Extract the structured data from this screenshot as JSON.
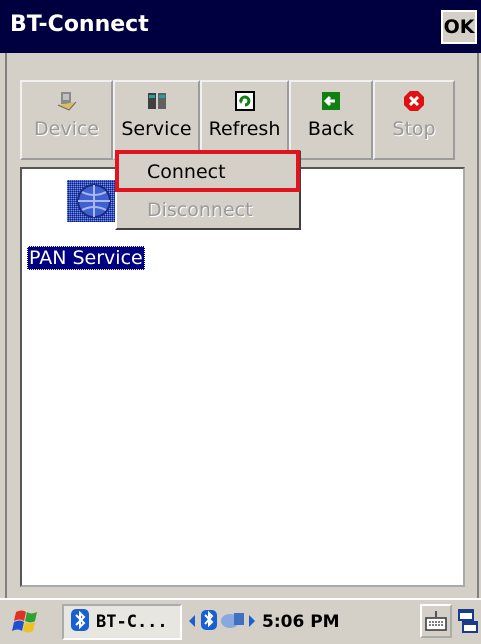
{
  "window": {
    "title": "BT-Connect",
    "ok_label": "OK"
  },
  "toolbar": {
    "items": [
      {
        "label": "Device",
        "icon": "device-icon",
        "enabled": false
      },
      {
        "label": "Service",
        "icon": "service-icon",
        "enabled": true
      },
      {
        "label": "Refresh",
        "icon": "refresh-icon",
        "enabled": true
      },
      {
        "label": "Back",
        "icon": "back-arrow-icon",
        "enabled": true
      },
      {
        "label": "Stop",
        "icon": "stop-icon",
        "enabled": false
      }
    ]
  },
  "services": [
    {
      "label": "PAN Service",
      "icon": "network-service-icon"
    }
  ],
  "context_menu": {
    "items": [
      {
        "label": "Connect",
        "enabled": true
      },
      {
        "label": "Disconnect",
        "enabled": false
      }
    ],
    "highlight_color": "#e0141c"
  },
  "taskbar": {
    "start_icon": "windows-flag-icon",
    "task_label": "BT-C...",
    "task_icon": "bluetooth-icon",
    "time": "5:06 PM",
    "tray_icons": [
      "left-arrow-icon",
      "bluetooth-icon",
      "network-icon",
      "right-arrow-icon"
    ],
    "keyboard_icon": "keyboard-icon",
    "window_switch_icon": "window-switch-icon"
  },
  "colors": {
    "title_bar": "#000040",
    "selection": "#000080",
    "face": "#d4d0c8"
  }
}
